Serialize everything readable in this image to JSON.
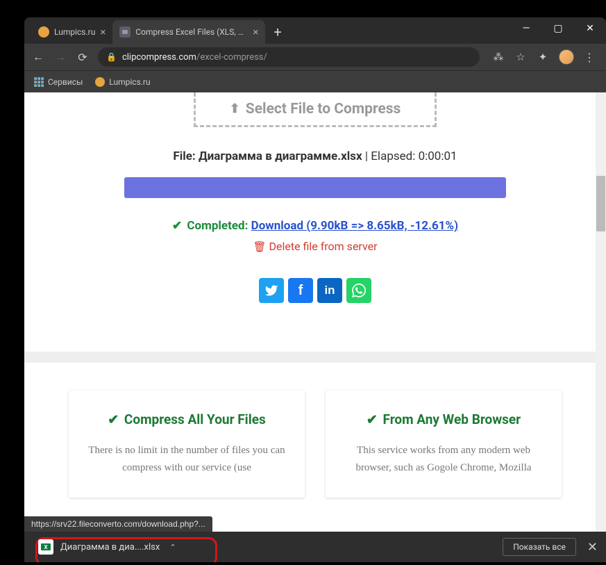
{
  "tabs": [
    {
      "title": "Lumpics.ru"
    },
    {
      "title": "Compress Excel Files (XLS, XLSX,"
    }
  ],
  "address": {
    "host": "clipcompress.com",
    "path": "/excel-compress/"
  },
  "bookmarks": {
    "services": "Сервисы",
    "lumpics": "Lumpics.ru"
  },
  "dropzone": {
    "label": "Select File to Compress"
  },
  "fileinfo": {
    "prefix": "File: ",
    "name": "Диаграмма в диаграмме.xlsx",
    "elapsed_label": " | Elapsed: ",
    "elapsed": "0:00:01"
  },
  "completed": {
    "label": "Completed: ",
    "link": "Download (9.90kB => 8.65kB, -12.61%)"
  },
  "delete_label": "Delete file from server",
  "cards": [
    {
      "title": "Compress All Your Files",
      "text": "There is no limit in the number of files you can compress with our service (use"
    },
    {
      "title": "From Any Web Browser",
      "text": "This service works from any modern web browser, such as Gogole Chrome, Mozilla"
    }
  ],
  "status_url": "https://srv22.fileconverto.com/download.php?...",
  "download": {
    "filename": "Диаграмма в диа....xlsx",
    "show_all": "Показать все"
  }
}
